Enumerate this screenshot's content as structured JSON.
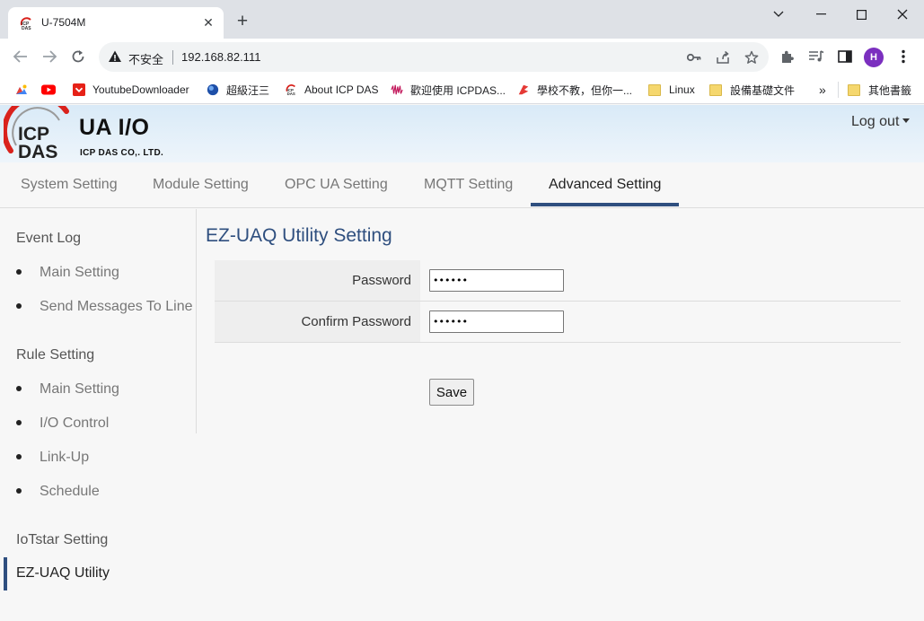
{
  "browser": {
    "tab_title": "U-7504M",
    "tab_close": "✕",
    "new_tab": "+",
    "insecure_label": "不安全",
    "url": "192.168.82.111",
    "avatar_initial": "H",
    "bookmarks": [
      {
        "label": "",
        "icon": "chrome-apps-icon"
      },
      {
        "label": "",
        "icon": "youtube-icon"
      },
      {
        "label": "YoutubeDownloader",
        "icon": "downloader-icon"
      },
      {
        "label": "超級汪三",
        "icon": "globe-icon"
      },
      {
        "label": "About ICP DAS",
        "icon": "icpdas-icon"
      },
      {
        "label": "歡迎使用 ICPDAS...",
        "icon": "waveform-icon"
      },
      {
        "label": "學校不教，但你一...",
        "icon": "flag-icon"
      },
      {
        "label": "Linux",
        "icon": "folder-icon"
      },
      {
        "label": "設備基礎文件",
        "icon": "folder-icon"
      }
    ],
    "overflow": "»",
    "other_bookmarks": "其他書籤"
  },
  "app": {
    "brand_title": "UA I/O",
    "company": "ICP DAS CO,. LTD.",
    "logo_text_top": "ICP",
    "logo_text_bottom": "DAS",
    "logout": "Log out",
    "nav_tabs": [
      "System Setting",
      "Module Setting",
      "OPC UA Setting",
      "MQTT Setting",
      "Advanced Setting"
    ],
    "active_nav": "Advanced Setting"
  },
  "sidebar": {
    "event_log": {
      "title": "Event Log",
      "items": [
        "Main Setting",
        "Send Messages To Line"
      ]
    },
    "rule_setting": {
      "title": "Rule Setting",
      "items": [
        "Main Setting",
        "I/O Control",
        "Link-Up",
        "Schedule"
      ]
    },
    "iotstar": {
      "title": "IoTstar Setting"
    },
    "ez_uaq": {
      "title": "EZ-UAQ Utility"
    }
  },
  "content": {
    "title": "EZ-UAQ Utility Setting",
    "password": {
      "label": "Password",
      "value": "123456"
    },
    "confirm_password": {
      "label": "Confirm Password",
      "value": "123456"
    },
    "save": "Save"
  },
  "colors": {
    "accent": "#2f4f7f",
    "logo_red": "#d9221c",
    "header_bg": "#d9eaf7"
  }
}
